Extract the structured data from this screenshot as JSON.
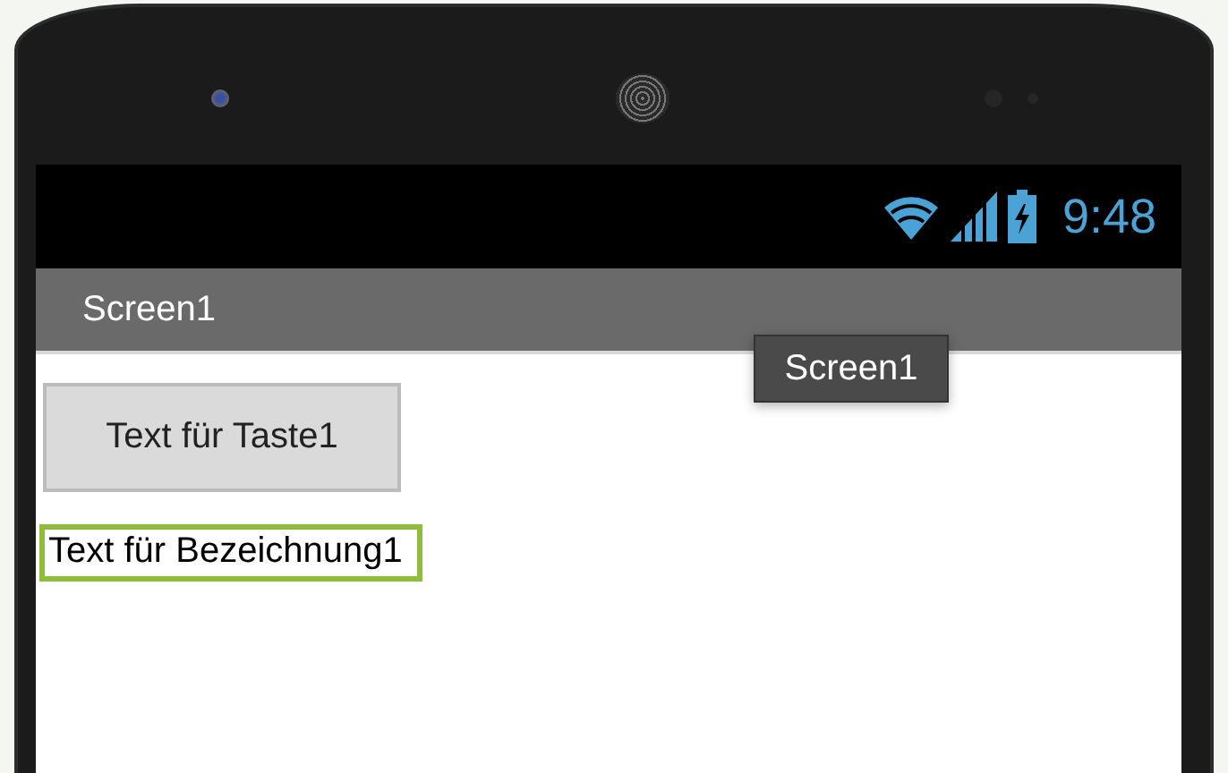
{
  "status_bar": {
    "time": "9:48"
  },
  "title_bar": {
    "title": "Screen1"
  },
  "tooltip": {
    "text": "Screen1"
  },
  "components": [
    {
      "kind": "button",
      "text": "Text für Taste1",
      "selected": false
    },
    {
      "kind": "label",
      "text": "Text für Bezeichnung1",
      "selected": true
    }
  ]
}
